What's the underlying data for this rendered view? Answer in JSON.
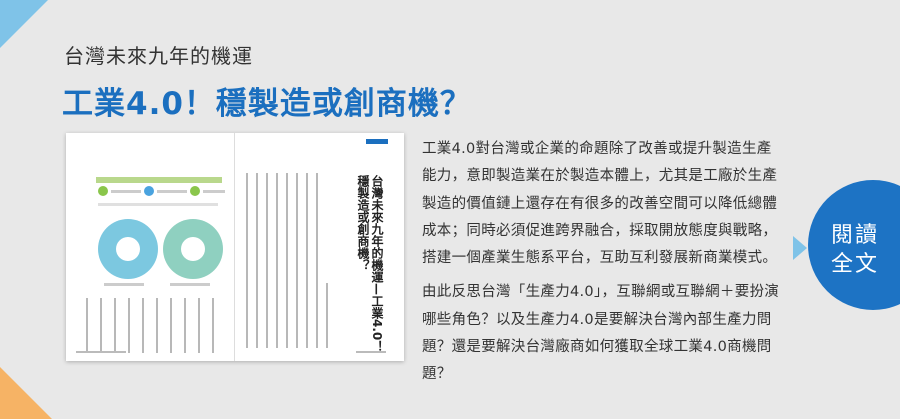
{
  "header": {
    "subtitle": "台灣未來九年的機運",
    "title": "工業4.0！穩製造或創商機？"
  },
  "magazine_thumbnail": {
    "vertical_title": "台灣未來九年的機運—工業4.0！穩製造或創商機？"
  },
  "body": {
    "paragraphs": [
      "工業4.0對台灣或企業的命題除了改善或提升製造生產能力，意即製造業在於製造本體上，尤其是工廠於生產製造的價值鏈上還存在有很多的改善空間可以降低總體成本；同時必須促進跨界融合，採取開放態度與戰略，搭建一個產業生態系平台，互助互利發展新商業模式。",
      "由此反思台灣「生產力4.0」，互聯網或互聯網＋要扮演哪些角色？以及生產力4.0是要解決台灣內部生產力問題？還是要解決台灣廠商如何獲取全球工業4.0商機問題？"
    ]
  },
  "cta": {
    "line1": "閱讀",
    "line2": "全文"
  },
  "colors": {
    "accent_blue": "#1d73c4",
    "title_blue": "#1b6fbf",
    "corner_light_blue": "#7fc3e8",
    "corner_orange": "#f6b365",
    "background": "#e8e8e8"
  }
}
